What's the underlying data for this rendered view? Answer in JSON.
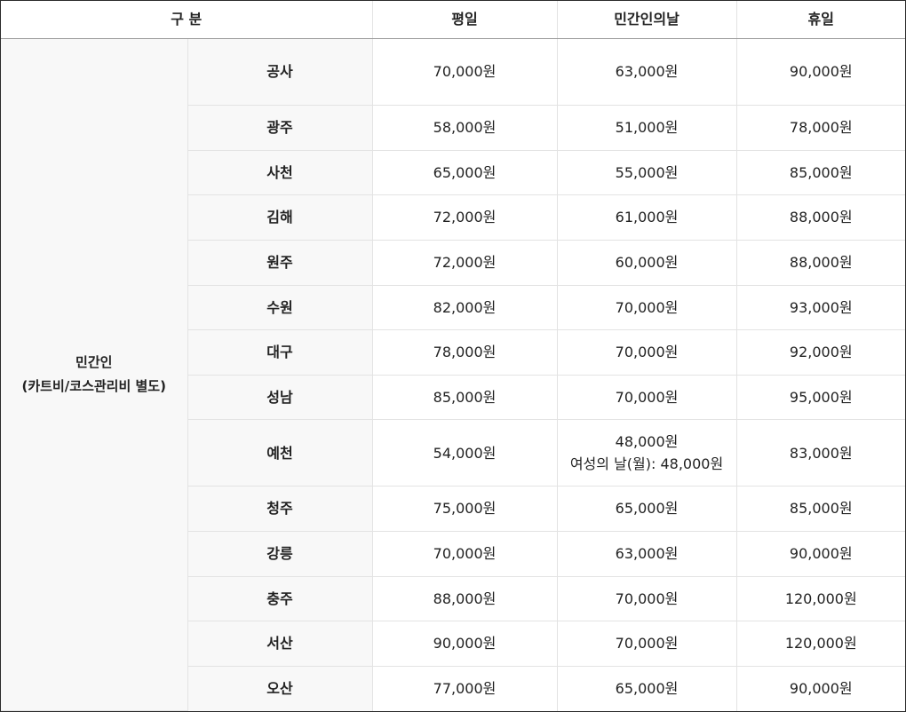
{
  "header": {
    "category": "구 분",
    "weekday": "평일",
    "civilian_day": "민간인의날",
    "holiday": "휴일"
  },
  "group": {
    "label": "민간인",
    "sub_label": "(카트비/코스관리비 별도)"
  },
  "rows": [
    {
      "region": "공사",
      "weekday": "70,000원",
      "civilian_day": "63,000원",
      "civilian_note": "",
      "holiday": "90,000원"
    },
    {
      "region": "광주",
      "weekday": "58,000원",
      "civilian_day": "51,000원",
      "civilian_note": "",
      "holiday": "78,000원"
    },
    {
      "region": "사천",
      "weekday": "65,000원",
      "civilian_day": "55,000원",
      "civilian_note": "",
      "holiday": "85,000원"
    },
    {
      "region": "김해",
      "weekday": "72,000원",
      "civilian_day": "61,000원",
      "civilian_note": "",
      "holiday": "88,000원"
    },
    {
      "region": "원주",
      "weekday": "72,000원",
      "civilian_day": "60,000원",
      "civilian_note": "",
      "holiday": "88,000원"
    },
    {
      "region": "수원",
      "weekday": "82,000원",
      "civilian_day": "70,000원",
      "civilian_note": "",
      "holiday": "93,000원"
    },
    {
      "region": "대구",
      "weekday": "78,000원",
      "civilian_day": "70,000원",
      "civilian_note": "",
      "holiday": "92,000원"
    },
    {
      "region": "성남",
      "weekday": "85,000원",
      "civilian_day": "70,000원",
      "civilian_note": "",
      "holiday": "95,000원"
    },
    {
      "region": "예천",
      "weekday": "54,000원",
      "civilian_day": "48,000원",
      "civilian_note": "여성의 날(월): 48,000원",
      "holiday": "83,000원"
    },
    {
      "region": "청주",
      "weekday": "75,000원",
      "civilian_day": "65,000원",
      "civilian_note": "",
      "holiday": "85,000원"
    },
    {
      "region": "강릉",
      "weekday": "70,000원",
      "civilian_day": "63,000원",
      "civilian_note": "",
      "holiday": "90,000원"
    },
    {
      "region": "충주",
      "weekday": "88,000원",
      "civilian_day": "70,000원",
      "civilian_note": "",
      "holiday": "120,000원"
    },
    {
      "region": "서산",
      "weekday": "90,000원",
      "civilian_day": "70,000원",
      "civilian_note": "",
      "holiday": "120,000원"
    },
    {
      "region": "오산",
      "weekday": "77,000원",
      "civilian_day": "65,000원",
      "civilian_note": "",
      "holiday": "90,000원"
    }
  ]
}
